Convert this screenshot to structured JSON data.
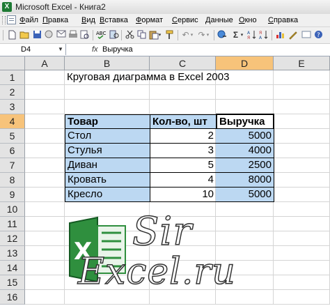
{
  "window": {
    "title": "Microsoft Excel - Книга2"
  },
  "menu": [
    {
      "label": "Файл",
      "key": "Ф"
    },
    {
      "label": "Правка",
      "key": "П"
    },
    {
      "label": "Вид",
      "key": "В"
    },
    {
      "label": "Вставка",
      "key": "В"
    },
    {
      "label": "Формат",
      "key": "Ф"
    },
    {
      "label": "Сервис",
      "key": "С"
    },
    {
      "label": "Данные",
      "key": "Д"
    },
    {
      "label": "Окно",
      "key": "О"
    },
    {
      "label": "Справка",
      "key": "С"
    }
  ],
  "toolbar": {
    "sum_symbol": "Σ"
  },
  "formula_bar": {
    "cell_ref": "D4",
    "fx": "fx",
    "value": "Выручка"
  },
  "columns": [
    "A",
    "B",
    "C",
    "D",
    "E"
  ],
  "rows": [
    "1",
    "2",
    "3",
    "4",
    "5",
    "6",
    "7",
    "8",
    "9",
    "10",
    "11",
    "12",
    "13",
    "14",
    "15",
    "16"
  ],
  "sheet": {
    "title": "Круговая диаграмма в Excel 2003",
    "header": {
      "product": "Товар",
      "qty": "Кол-во, шт",
      "revenue": "Выручка"
    },
    "items": [
      {
        "product": "Стол",
        "qty": "2",
        "revenue": "5000"
      },
      {
        "product": "Стулья",
        "qty": "3",
        "revenue": "4000"
      },
      {
        "product": "Диван",
        "qty": "5",
        "revenue": "2500"
      },
      {
        "product": "Кровать",
        "qty": "4",
        "revenue": "8000"
      },
      {
        "product": "Кресло",
        "qty": "10",
        "revenue": "5000"
      }
    ]
  },
  "watermark": {
    "line1": "Sir",
    "line2": "Excel.ru"
  },
  "colors": {
    "selected_header": "#f7c37a",
    "table_fill": "#bcd8f2",
    "logo_green": "#1d7a34"
  }
}
